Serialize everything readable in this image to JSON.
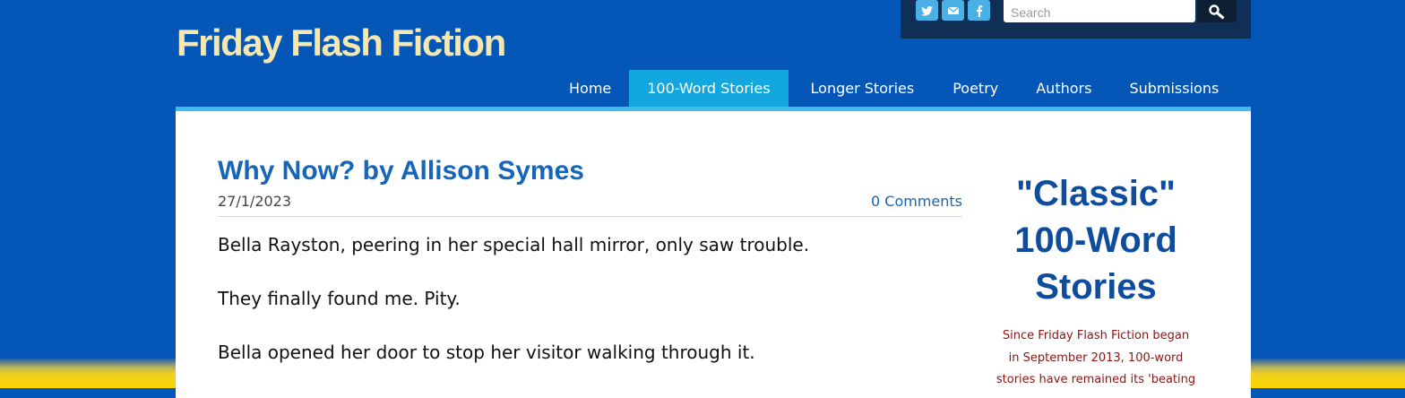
{
  "site": {
    "title": "Friday Flash Fiction"
  },
  "social": [
    {
      "name": "twitter-icon"
    },
    {
      "name": "mail-icon"
    },
    {
      "name": "facebook-icon"
    }
  ],
  "search": {
    "placeholder": "Search",
    "icon": "magnifier-icon"
  },
  "nav": {
    "items": [
      {
        "label": "Home",
        "active": false
      },
      {
        "label": "100-Word Stories",
        "active": true
      },
      {
        "label": "Longer Stories",
        "active": false
      },
      {
        "label": "Poetry",
        "active": false
      },
      {
        "label": "Authors",
        "active": false
      },
      {
        "label": "Submissions",
        "active": false
      }
    ]
  },
  "post": {
    "title": "Why Now? by Allison Symes",
    "date": "27/1/2023",
    "comments": "0 Comments",
    "paragraphs": [
      "Bella Rayston, peering in her special hall mirror, only saw trouble.",
      "They finally found me. Pity.",
      "Bella opened her door to stop her visitor walking through it."
    ]
  },
  "sidebar": {
    "title_lines": [
      "\"Classic\"",
      "100-Word",
      "Stories"
    ],
    "text_lines": [
      "Since Friday Flash Fiction began",
      "in September 2013, 100-word",
      "stories have remained its 'beating"
    ]
  },
  "colors": {
    "background": "#0457b7",
    "title": "#f4e7b0",
    "nav_active": "#12a7df",
    "accent_bar": "#41bde9",
    "post_title": "#1566b8",
    "sidebar_title": "#0f4d9c",
    "sidebar_text": "#8a1414",
    "ribbon_yellow": "#f6d400"
  }
}
